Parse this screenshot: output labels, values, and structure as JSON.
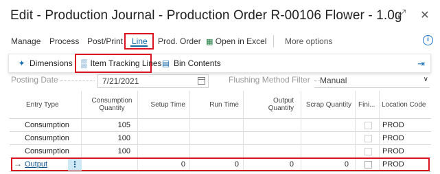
{
  "window": {
    "title": "Edit - Production Journal - Production Order R-00106 Flower - 1.0g",
    "expand_icon": "expand-icon",
    "close_icon": "close-icon"
  },
  "menu": {
    "items": [
      "Manage",
      "Process",
      "Post/Print",
      "Line",
      "Prod. Order",
      "Open in Excel",
      "More options"
    ],
    "active": "Line"
  },
  "actions": {
    "dimensions": "Dimensions",
    "item_tracking_lines": "Item Tracking Lines",
    "bin_contents": "Bin Contents"
  },
  "filters": {
    "posting_date_label": "Posting Date",
    "posting_date_value": "7/21/2021",
    "flushing_label": "Flushing Method Filter",
    "flushing_value": "Manual"
  },
  "grid": {
    "headers": {
      "entry_type": "Entry Type",
      "consumption_qty": "Consumption Quantity",
      "setup_time": "Setup Time",
      "run_time": "Run Time",
      "output_qty": "Output Quantity",
      "scrap_qty": "Scrap Quantity",
      "finished": "Fini...",
      "location_code": "Location Code"
    },
    "rows": [
      {
        "entry_type": "Consumption",
        "consumption_qty": "105",
        "setup_time": "",
        "run_time": "",
        "output_qty": "",
        "scrap_qty": "",
        "location": "PROD"
      },
      {
        "entry_type": "Consumption",
        "consumption_qty": "100",
        "setup_time": "",
        "run_time": "",
        "output_qty": "",
        "scrap_qty": "",
        "location": "PROD"
      },
      {
        "entry_type": "Consumption",
        "consumption_qty": "100",
        "setup_time": "",
        "run_time": "",
        "output_qty": "",
        "scrap_qty": "",
        "location": "PROD"
      },
      {
        "entry_type": "Output",
        "consumption_qty": "",
        "setup_time": "0",
        "run_time": "0",
        "output_qty": "0",
        "scrap_qty": "0",
        "location": "PROD"
      }
    ]
  },
  "colors": {
    "highlight_red": "#d9141f",
    "accent_blue": "#0f6aa8"
  }
}
